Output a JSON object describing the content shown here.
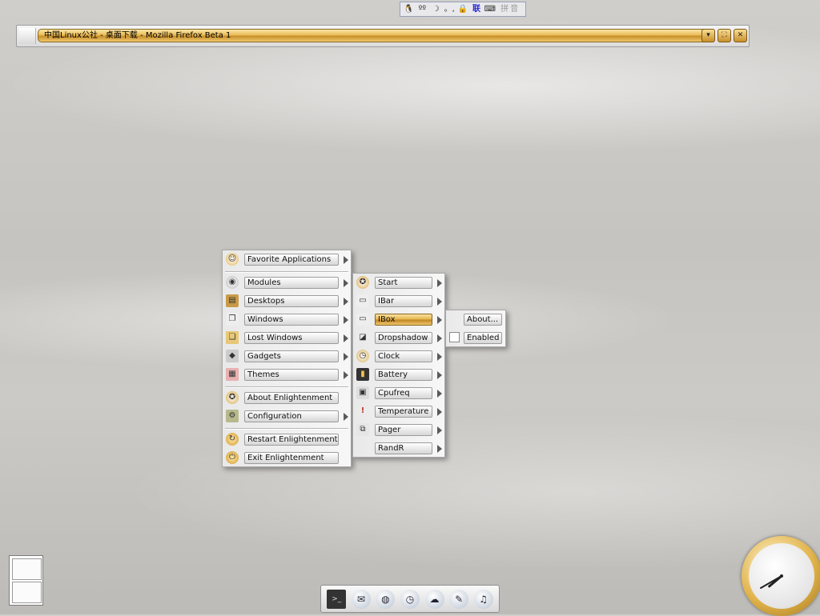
{
  "input_method_bar": {
    "icons": [
      "penguin-icon",
      "mode-icon",
      "moon-icon",
      "punct-icon",
      "lock-icon",
      "lian-icon",
      "keyboard-icon"
    ],
    "lian_label": "联",
    "pinyin_label": "拼音"
  },
  "window": {
    "title": "中国Linux公社 - 桌面下载 - Mozilla Firefox Beta 1",
    "buttons": [
      "shade",
      "maximize",
      "close"
    ]
  },
  "main_menu": {
    "favorite": "Favorite Applications",
    "items": [
      {
        "label": "Modules",
        "icon": "modules-icon",
        "has_sub": true
      },
      {
        "label": "Desktops",
        "icon": "desktops-icon",
        "has_sub": true
      },
      {
        "label": "Windows",
        "icon": "windows-icon",
        "has_sub": true
      },
      {
        "label": "Lost Windows",
        "icon": "lost-windows-icon",
        "has_sub": true
      },
      {
        "label": "Gadgets",
        "icon": "gadgets-icon",
        "has_sub": true
      },
      {
        "label": "Themes",
        "icon": "themes-icon",
        "has_sub": true
      }
    ],
    "items2": [
      {
        "label": "About Enlightenment",
        "icon": "about-icon",
        "has_sub": false
      },
      {
        "label": "Configuration",
        "icon": "configuration-icon",
        "has_sub": true
      }
    ],
    "items3": [
      {
        "label": "Restart Enlightenment",
        "icon": "restart-icon",
        "has_sub": false
      },
      {
        "label": "Exit Enlightenment",
        "icon": "exit-icon",
        "has_sub": false
      }
    ]
  },
  "modules_menu": {
    "items": [
      "Start",
      "IBar",
      "IBox",
      "Dropshadow",
      "Clock",
      "Battery",
      "Cpufreq",
      "Temperature",
      "Pager",
      "RandR"
    ],
    "active": "IBox"
  },
  "ibox_menu": {
    "about": "About...",
    "enabled": "Enabled"
  },
  "dock": {
    "icons": [
      "terminal-icon",
      "mail-icon",
      "browser-icon",
      "clock-app-icon",
      "chat-icon",
      "gimp-icon",
      "media-icon"
    ]
  },
  "clock": {
    "hour": 7,
    "minute": 40
  }
}
